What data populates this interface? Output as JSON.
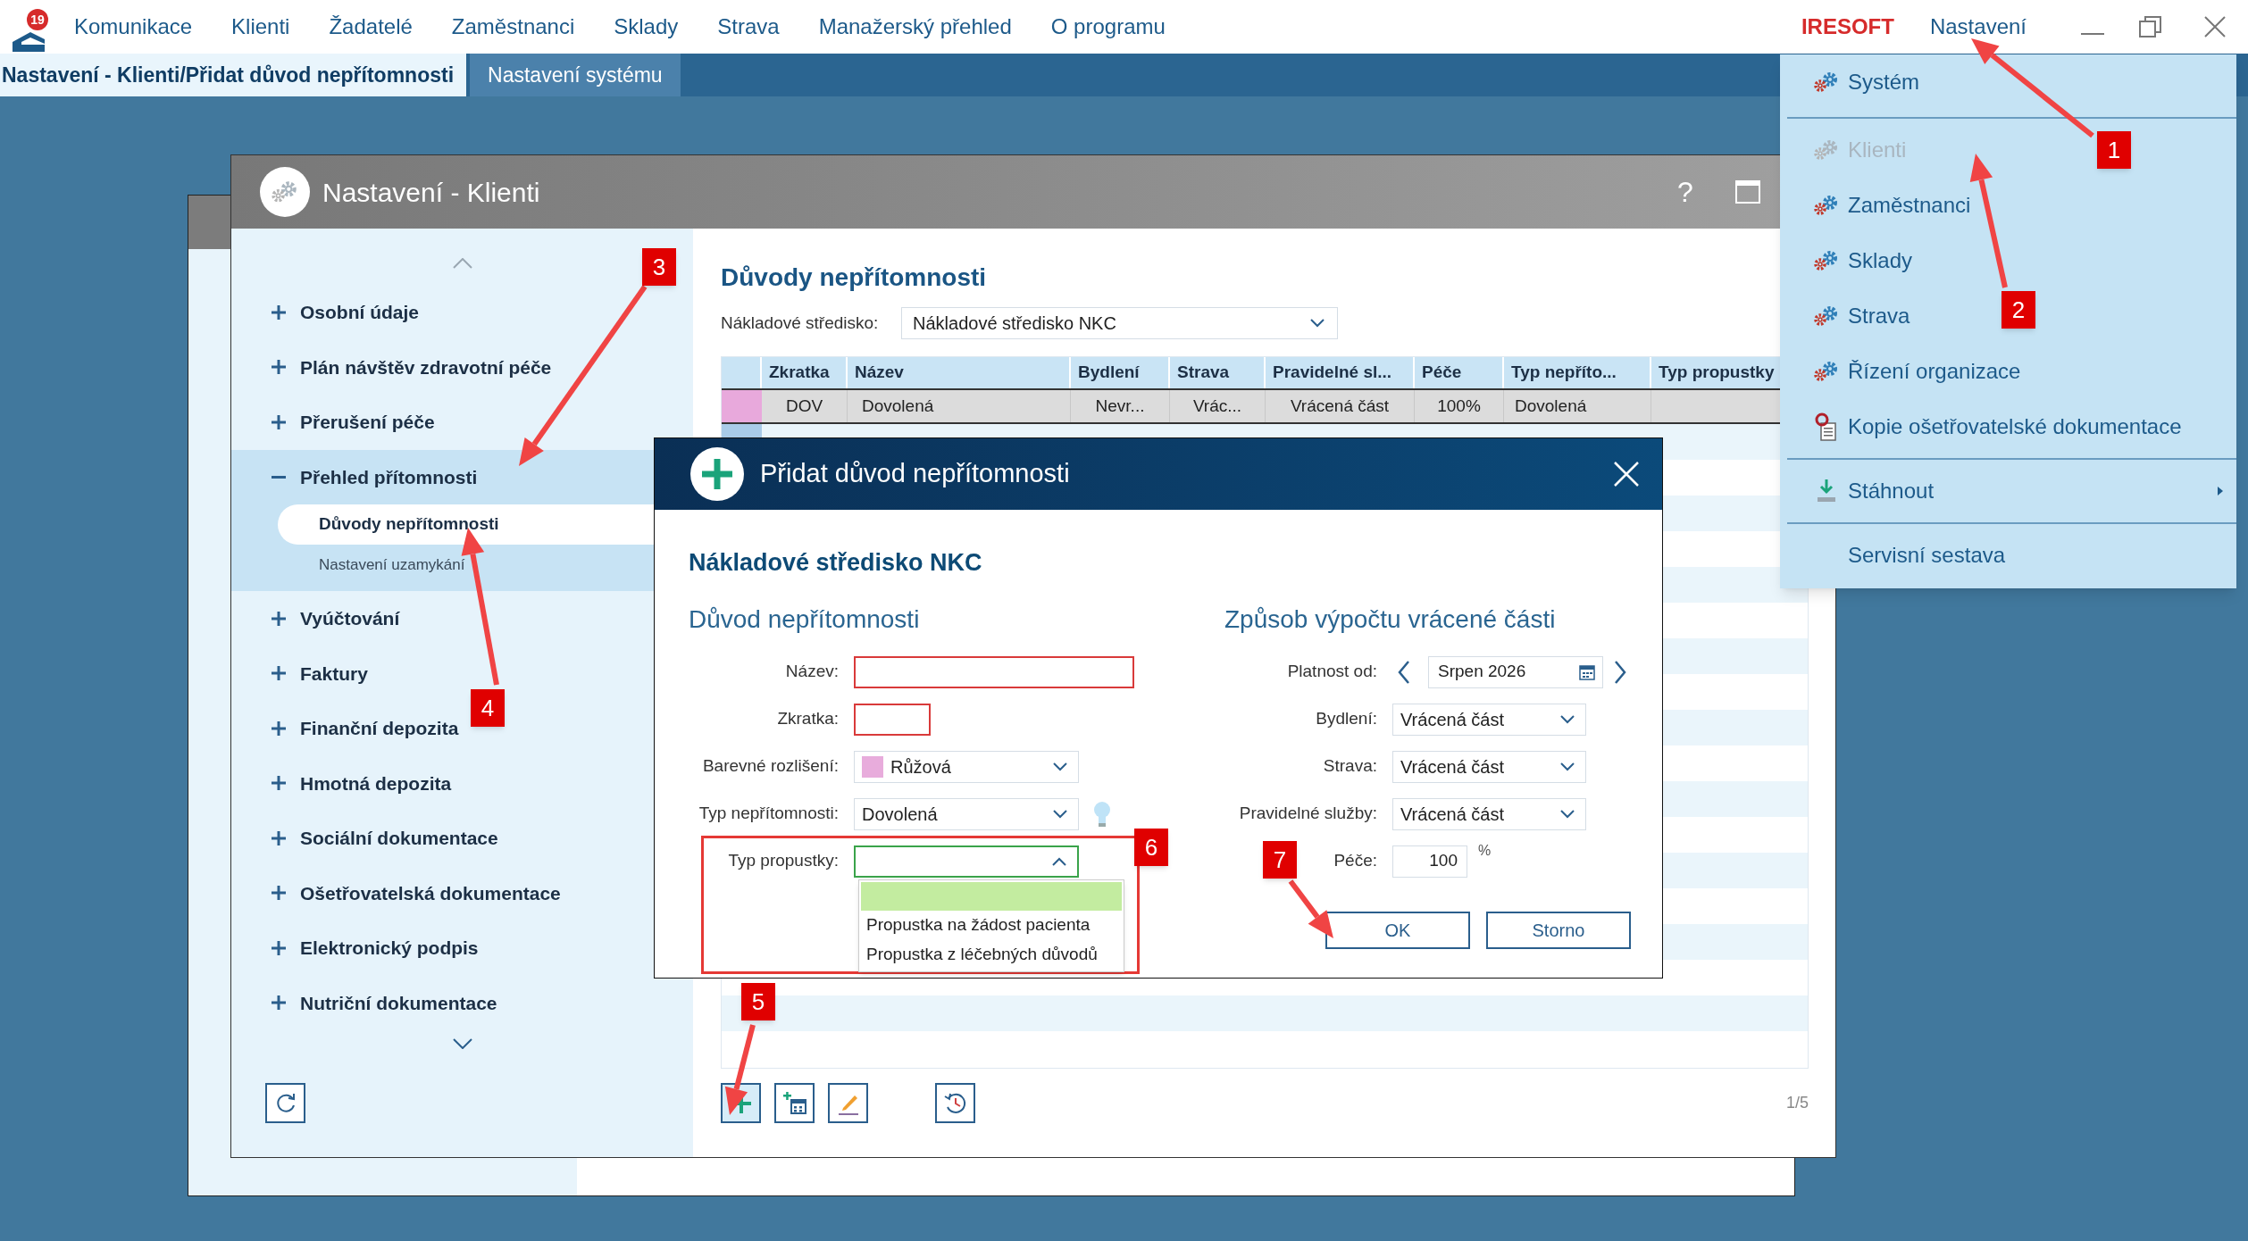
{
  "app_bar": {
    "notification_count": "19",
    "menu": [
      "Komunikace",
      "Klienti",
      "Žadatelé",
      "Zaměstnanci",
      "Sklady",
      "Strava",
      "Manažerský přehled",
      "O programu"
    ],
    "brand": "IRESOFT",
    "settings_label": "Nastavení"
  },
  "tabs": [
    {
      "label": "Nastavení - Klienti/Přidat důvod nepřítomnosti",
      "selected": true
    },
    {
      "label": "Nastavení systému",
      "selected": false
    }
  ],
  "window": {
    "title": "Nastavení - Klienti",
    "help_button": "?",
    "sidebar": [
      {
        "label": "Osobní údaje",
        "expanded": false
      },
      {
        "label": "Plán návštěv zdravotní péče",
        "expanded": false
      },
      {
        "label": "Přerušení péče",
        "expanded": false
      },
      {
        "label": "Přehled přítomnosti",
        "expanded": true,
        "children": [
          {
            "label": "Důvody nepřítomnosti",
            "selected": true
          },
          {
            "label": "Nastavení uzamykání",
            "selected": false
          }
        ]
      },
      {
        "label": "Vyúčtování",
        "expanded": false
      },
      {
        "label": "Faktury",
        "expanded": false
      },
      {
        "label": "Finanční depozita",
        "expanded": false
      },
      {
        "label": "Hmotná depozita",
        "expanded": false
      },
      {
        "label": "Sociální dokumentace",
        "expanded": false
      },
      {
        "label": "Ošetřovatelská dokumentace",
        "expanded": false
      },
      {
        "label": "Elektronický podpis",
        "expanded": false
      },
      {
        "label": "Nutriční dokumentace",
        "expanded": false
      }
    ],
    "heading": "Důvody nepřítomnosti",
    "cost_center": {
      "label": "Nákladové středisko:",
      "value": "Nákladové středisko NKC"
    },
    "table": {
      "columns": [
        "Zkratka",
        "Název",
        "Bydlení",
        "Strava",
        "Pravidelné sl...",
        "Péče",
        "Typ nepříto...",
        "Typ propustky"
      ],
      "rows": [
        {
          "color": "#e8a9dc",
          "selected": true,
          "cells": [
            "DOV",
            "Dovolená",
            "Nevr...",
            "Vrác...",
            "Vrácená část",
            "100%",
            "Dovolená"
          ]
        },
        {
          "color": "#a9cbe8",
          "selected": false
        }
      ]
    },
    "page_indicator": "1/5"
  },
  "dialog": {
    "title": "Přidat důvod nepřítomnosti",
    "cost_center": "Nákladové středisko NKC",
    "left": {
      "heading": "Důvod nepřítomnosti",
      "fields": [
        {
          "kind": "text",
          "label": "Název:",
          "required": true
        },
        {
          "kind": "text",
          "label": "Zkratka:",
          "required": true
        },
        {
          "kind": "select",
          "label": "Barevné rozlišení:",
          "value": "Růžová",
          "color": "#e8acdc",
          "open": false
        },
        {
          "kind": "select",
          "label": "Typ nepřítomnosti:",
          "value": "Dovolená",
          "open": false,
          "hint": true
        },
        {
          "kind": "select",
          "label": "Typ propustky:",
          "open": true,
          "options": [
            {
              "selected": true
            },
            {
              "label": "Propustka na žádost pacienta",
              "selected": false
            },
            {
              "label": "Propustka z léčebných důvodů",
              "selected": false
            }
          ]
        }
      ]
    },
    "right": {
      "heading": "Způsob výpočtu vrácené části",
      "fields": [
        {
          "kind": "month",
          "label": "Platnost od:",
          "value": "Srpen 2026"
        },
        {
          "kind": "select",
          "label": "Bydlení:",
          "value": "Vrácená část",
          "open": false
        },
        {
          "kind": "select",
          "label": "Strava:",
          "value": "Vrácená část",
          "open": false
        },
        {
          "kind": "select",
          "label": "Pravidelné služby:",
          "value": "Vrácená část",
          "open": false
        },
        {
          "kind": "number",
          "label": "Péče:",
          "value": "100",
          "unit": "%"
        }
      ]
    },
    "buttons": [
      "OK",
      "Storno"
    ]
  },
  "settings_menu": {
    "groups": [
      [
        {
          "label": "Systém",
          "kind": "gears",
          "disabled": false,
          "submenu": false
        }
      ],
      [
        {
          "label": "Klienti",
          "kind": "gears",
          "disabled": true,
          "submenu": false
        },
        {
          "label": "Zaměstnanci",
          "kind": "gears",
          "disabled": false,
          "submenu": false
        },
        {
          "label": "Sklady",
          "kind": "gears",
          "disabled": false,
          "submenu": false
        },
        {
          "label": "Strava",
          "kind": "gears",
          "disabled": false,
          "submenu": false
        },
        {
          "label": "Řízení organizace",
          "kind": "gears",
          "disabled": false,
          "submenu": false
        },
        {
          "label": "Kopie ošetřovatelské dokumentace",
          "kind": "document",
          "disabled": false,
          "submenu": false
        }
      ],
      [
        {
          "label": "Stáhnout",
          "kind": "download",
          "disabled": false,
          "submenu": true
        }
      ],
      [
        {
          "label": "Servisní sestava",
          "kind": "plain",
          "disabled": false,
          "submenu": false
        }
      ]
    ]
  },
  "annotations": [
    {
      "label": "1"
    },
    {
      "label": "2"
    },
    {
      "label": "3"
    },
    {
      "label": "4"
    },
    {
      "label": "5"
    },
    {
      "label": "6"
    },
    {
      "label": "7"
    }
  ]
}
